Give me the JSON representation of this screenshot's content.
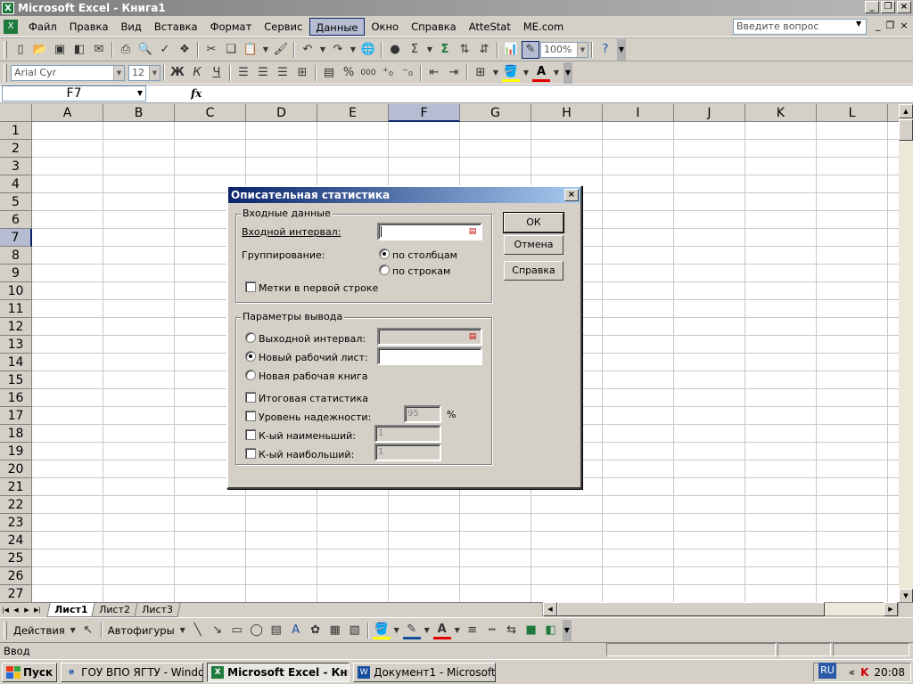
{
  "window": {
    "title": "Microsoft Excel - Книга1"
  },
  "menu": {
    "items": [
      "Файл",
      "Правка",
      "Вид",
      "Вставка",
      "Формат",
      "Сервис",
      "Данные",
      "Окно",
      "Справка",
      "AtteStat",
      "ME.com"
    ],
    "active_index": 6,
    "ask_placeholder": "Введите вопрос"
  },
  "toolbar_standard": {
    "zoom": "100%"
  },
  "toolbar_format": {
    "font": "Arial Cyr",
    "size": "12",
    "bold": "Ж",
    "italic": "К",
    "underline": "Ч",
    "percent": "%",
    "thousands": "000"
  },
  "formula_bar": {
    "name_box": "F7",
    "fx": "fx"
  },
  "grid": {
    "columns": [
      "A",
      "B",
      "C",
      "D",
      "E",
      "F",
      "G",
      "H",
      "I",
      "J",
      "K",
      "L"
    ],
    "rows": [
      "1",
      "2",
      "3",
      "4",
      "5",
      "6",
      "7",
      "8",
      "9",
      "10",
      "11",
      "12",
      "13",
      "14",
      "15",
      "16",
      "17",
      "18",
      "19",
      "20",
      "21",
      "22",
      "23",
      "24",
      "25",
      "26",
      "27"
    ],
    "selected_column": "F",
    "selected_row": "7"
  },
  "sheets": {
    "tabs": [
      "Лист1",
      "Лист2",
      "Лист3"
    ],
    "active": "Лист1"
  },
  "drawing_toolbar": {
    "actions": "Действия",
    "autoshapes": "Автофигуры"
  },
  "status": {
    "text": "Ввод"
  },
  "taskbar": {
    "start": "Пуск",
    "tasks": [
      "ГОУ ВПО ЯГТУ - Windo...",
      "Microsoft Excel - Книг...",
      "Документ1 - Microsoft ..."
    ],
    "active_task": 1,
    "lang": "RU",
    "time": "20:08"
  },
  "dialog": {
    "title": "Описательная статистика",
    "input_group": "Входные данные",
    "input_range_label": "Входной интервал:",
    "grouping_label": "Группирование:",
    "by_columns": "по столбцам",
    "by_rows": "по строкам",
    "labels_first_row": "Метки в первой строке",
    "output_group": "Параметры вывода",
    "output_range_label": "Выходной интервал:",
    "new_sheet_label": "Новый рабочий лист:",
    "new_workbook_label": "Новая рабочая книга",
    "summary_stats": "Итоговая статистика",
    "confidence_level": "Уровень надежности:",
    "confidence_value": "95",
    "percent": "%",
    "kth_smallest": "К-ый наименьший:",
    "kth_smallest_value": "1",
    "kth_largest": "К-ый наибольший:",
    "kth_largest_value": "1",
    "ok": "ОК",
    "cancel": "Отмена",
    "help": "Справка"
  }
}
